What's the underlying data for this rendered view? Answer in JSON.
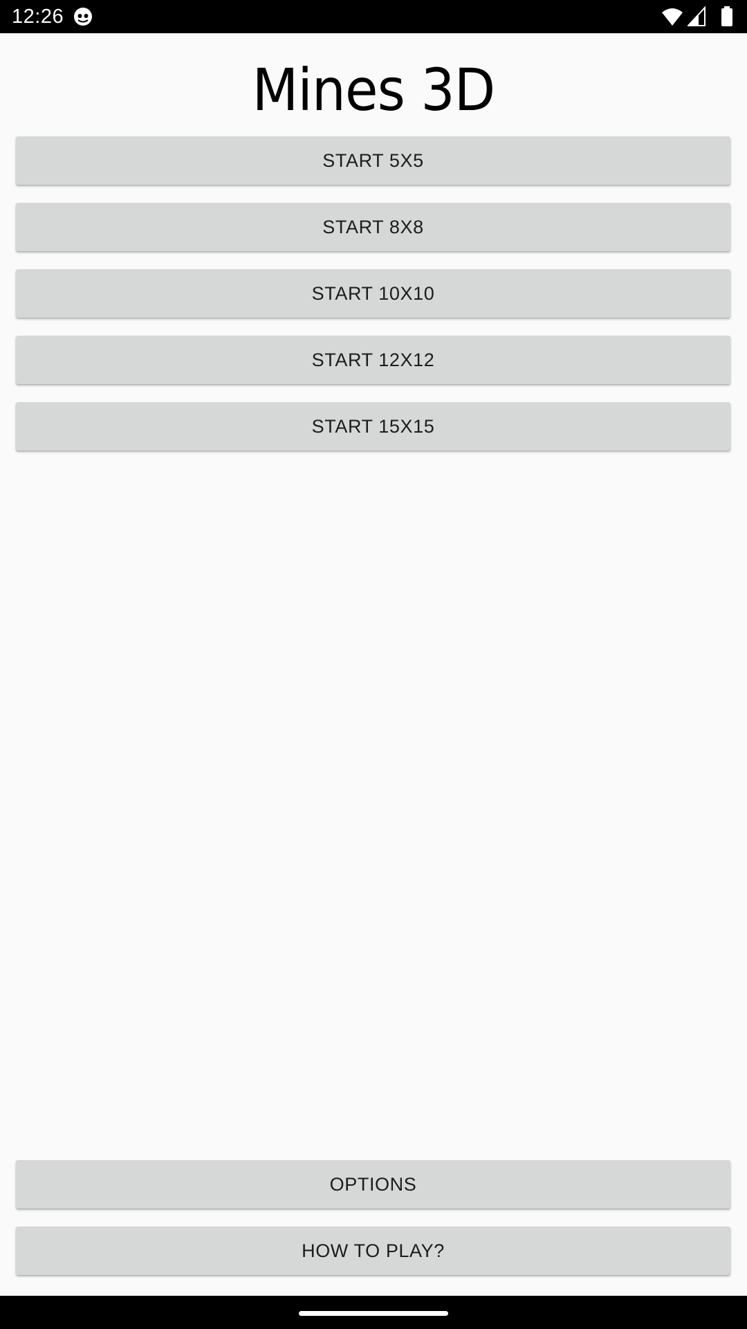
{
  "status_bar": {
    "time": "12:26",
    "icons": [
      "app-notification-icon",
      "wifi-icon",
      "signal-icon",
      "battery-icon"
    ]
  },
  "app": {
    "title": "Mines 3D"
  },
  "start_buttons": [
    {
      "label": "START 5X5"
    },
    {
      "label": "START 8X8"
    },
    {
      "label": "START 10X10"
    },
    {
      "label": "START 12X12"
    },
    {
      "label": "START 15X15"
    }
  ],
  "footer_buttons": {
    "options": "OPTIONS",
    "how_to_play": "HOW TO PLAY?"
  },
  "colors": {
    "background": "#fafafa",
    "button": "#d6d7d7",
    "button_text": "#1c1c1c",
    "system_bars": "#000000"
  }
}
